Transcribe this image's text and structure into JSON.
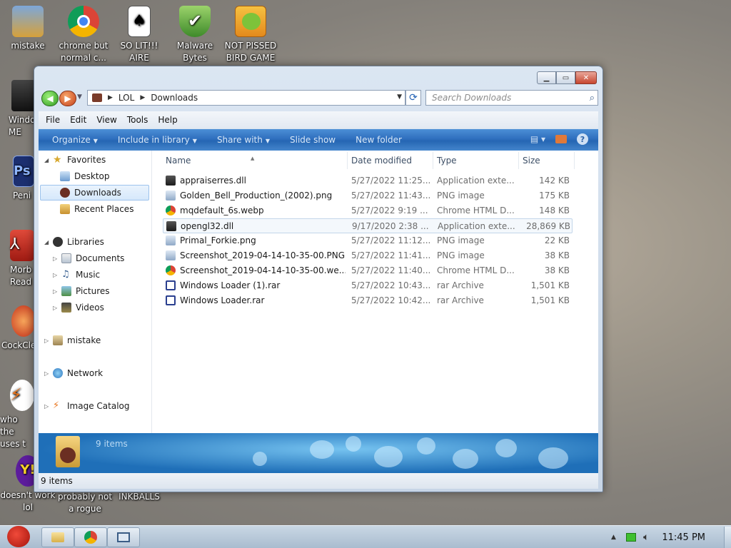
{
  "desktop": {
    "icons": [
      {
        "label": "mistake"
      },
      {
        "label": "chrome but normal c..."
      },
      {
        "label": "SO LIT!!! AIRE"
      },
      {
        "label": "Malware Bytes"
      },
      {
        "label": "NOT PISSED BIRD GAME"
      },
      {
        "label": "Windo ME"
      },
      {
        "label": "Peni"
      },
      {
        "label": "Morb Read"
      },
      {
        "label": "CockCle"
      },
      {
        "label": "who the uses t"
      },
      {
        "label": "doesn't work lol"
      },
      {
        "label": "probably not a rogue"
      },
      {
        "label": "INKBALLS"
      }
    ]
  },
  "window": {
    "address": {
      "root": "LOL",
      "current": "Downloads"
    },
    "search_placeholder": "Search Downloads",
    "menu": [
      "File",
      "Edit",
      "View",
      "Tools",
      "Help"
    ],
    "commands": [
      {
        "label": "Organize",
        "dropdown": true
      },
      {
        "label": "Include in library",
        "dropdown": true
      },
      {
        "label": "Share with",
        "dropdown": true
      },
      {
        "label": "Slide show",
        "dropdown": false
      },
      {
        "label": "New folder",
        "dropdown": false
      }
    ],
    "help_label": "?",
    "nav": {
      "favorites": "Favorites",
      "fav_items": [
        "Desktop",
        "Downloads",
        "Recent Places"
      ],
      "libraries": "Libraries",
      "lib_items": [
        "Documents",
        "Music",
        "Pictures",
        "Videos"
      ],
      "mistake": "mistake",
      "network": "Network",
      "catalog": "Image Catalog"
    },
    "columns": {
      "name": "Name",
      "date": "Date modified",
      "type": "Type",
      "size": "Size"
    },
    "files": [
      {
        "name": "appraiserres.dll",
        "date": "5/27/2022 11:25...",
        "type": "Application exte...",
        "size": "142 KB",
        "icon": "dll-icon"
      },
      {
        "name": "Golden_Bell_Production_(2002).png",
        "date": "5/27/2022 11:43...",
        "type": "PNG image",
        "size": "175 KB",
        "icon": "image-icon"
      },
      {
        "name": "mqdefault_6s.webp",
        "date": "5/27/2022 9:19 ...",
        "type": "Chrome HTML D...",
        "size": "148 KB",
        "icon": "chrome-icon"
      },
      {
        "name": "opengl32.dll",
        "date": "9/17/2020 2:38 ...",
        "type": "Application exte...",
        "size": "28,869 KB",
        "icon": "dll-icon"
      },
      {
        "name": "Primal_Forkie.png",
        "date": "5/27/2022 11:12...",
        "type": "PNG image",
        "size": "22 KB",
        "icon": "image-icon"
      },
      {
        "name": "Screenshot_2019-04-14-10-35-00.PNG",
        "date": "5/27/2022 11:41...",
        "type": "PNG image",
        "size": "38 KB",
        "icon": "image-icon"
      },
      {
        "name": "Screenshot_2019-04-14-10-35-00.we...",
        "date": "5/27/2022 11:40...",
        "type": "Chrome HTML D...",
        "size": "38 KB",
        "icon": "chrome-icon"
      },
      {
        "name": "Windows Loader (1).rar",
        "date": "5/27/2022 10:43...",
        "type": "rar Archive",
        "size": "1,501 KB",
        "icon": "rar-icon"
      },
      {
        "name": "Windows Loader.rar",
        "date": "5/27/2022 10:42...",
        "type": "rar Archive",
        "size": "1,501 KB",
        "icon": "rar-icon"
      }
    ],
    "details_count": "9 items",
    "status": "9 items"
  },
  "taskbar": {
    "clock": "11:45 PM"
  },
  "colors": {
    "accent": "#2f6fbe",
    "selection": "#d6e8fb"
  }
}
